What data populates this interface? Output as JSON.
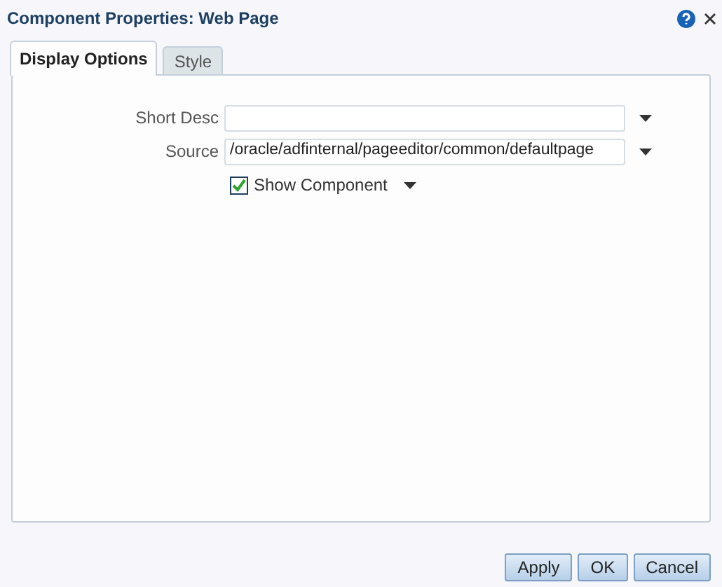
{
  "window": {
    "title": "Component Properties: Web Page"
  },
  "tabs": [
    {
      "label": "Display Options",
      "selected": true
    },
    {
      "label": "Style",
      "selected": false
    }
  ],
  "fields": [
    {
      "kind": "text",
      "label": "Short Desc"
    },
    {
      "kind": "text",
      "label": "Source",
      "value": "/oracle/adfinternal/pageeditor/common/defaultpage"
    },
    {
      "kind": "checkbox",
      "label": "Show Component",
      "checked": true
    }
  ],
  "buttons": [
    "Apply",
    "OK",
    "Cancel"
  ]
}
